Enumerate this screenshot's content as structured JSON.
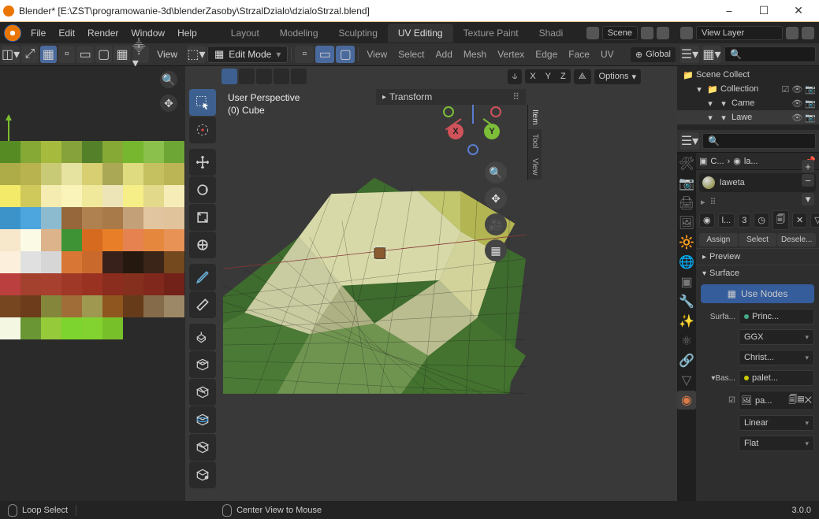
{
  "titlebar": {
    "title": "Blender* [E:\\ZST\\programowanie-3d\\blenderZasoby\\StrzalDzialo\\dzialoStrzal.blend]"
  },
  "topmenu": {
    "items": [
      "File",
      "Edit",
      "Render",
      "Window",
      "Help"
    ],
    "tabs": [
      "Layout",
      "Modeling",
      "Sculpting",
      "UV Editing",
      "Texture Paint",
      "Shadi"
    ],
    "active_tab": "UV Editing",
    "scene": "Scene",
    "viewlayer": "View Layer"
  },
  "uv_header": {
    "view": "View"
  },
  "vp_header": {
    "mode": "Edit Mode",
    "menus": [
      "View",
      "Select",
      "Add",
      "Mesh",
      "Vertex",
      "Edge",
      "Face",
      "UV"
    ],
    "orientation": "Global"
  },
  "vp_subheader": {
    "axes": [
      "X",
      "Y",
      "Z"
    ],
    "options": "Options"
  },
  "vp_info": {
    "perspective": "User Perspective",
    "object": "(0) Cube"
  },
  "npanel": {
    "header": "Transform",
    "tabs": [
      "Item",
      "Tool",
      "View"
    ]
  },
  "outliner": {
    "rows": [
      {
        "indent": 0,
        "icon": "📁",
        "name": "Scene Collect"
      },
      {
        "indent": 1,
        "icon": "📁",
        "name": "Collection",
        "toggles": [
          "☑",
          "👁",
          "📷"
        ]
      },
      {
        "indent": 2,
        "icon": "▾",
        "name": "Came",
        "toggles": [
          "👁",
          "📷"
        ]
      },
      {
        "indent": 2,
        "icon": "▾",
        "name": "Lawe",
        "toggles": [
          "👁",
          "📷"
        ],
        "sel": true
      }
    ]
  },
  "props": {
    "crumb_obj": "C...",
    "crumb_mat": "la...",
    "material": "laweta",
    "active_slot_index": "3",
    "link_label": "l...",
    "assign": "Assign",
    "select": "Select",
    "deselect": "Desele...",
    "preview": "Preview",
    "surface": "Surface",
    "usenodes": "Use Nodes",
    "surfa_label": "Surfa...",
    "shader": "Princ...",
    "ggx": "GGX",
    "christ": "Christ...",
    "base_label": "Bas...",
    "palette": "palet...",
    "pa_label": "pa...",
    "linear": "Linear",
    "flat": "Flat"
  },
  "status": {
    "left": "Loop Select",
    "hint": "Center View to Mouse",
    "version": "3.0.0"
  },
  "palette_colors": [
    "#568b24",
    "#86a936",
    "#a6ba3d",
    "#86a23a",
    "#54802a",
    "#86a936",
    "#77b72f",
    "#8ac04b",
    "#6ea636",
    "#aeac48",
    "#b8b34e",
    "#c9ca75",
    "#e6e2a0",
    "#d8cf73",
    "#aaa855",
    "#dedb80",
    "#c6c160",
    "#bcb555",
    "#f4ea6a",
    "#cfc85b",
    "#f4ecb0",
    "#fbf4ba",
    "#f0e99b",
    "#ede5b8",
    "#f6ee86",
    "#e2da8a",
    "#f6ecb8",
    "#3b93c9",
    "#4da6de",
    "#8cbbd0",
    "#95673b",
    "#b08150",
    "#a87949",
    "#c4a078",
    "#e1c5a0",
    "#e0c39b",
    "#f7e8cb",
    "#fbfae5",
    "#dcb38a",
    "#3e9435",
    "#d66a1e",
    "#e87f28",
    "#e68250",
    "#e5883d",
    "#e89255",
    "#fcf0dc",
    "#e0e0e0",
    "#d6d6d6",
    "#d87735",
    "#c96a2c",
    "#38211a",
    "#25180f",
    "#3a2518",
    "#74491e",
    "#bc3f3f",
    "#a4412e",
    "#a84030",
    "#a03828",
    "#9a3222",
    "#8a2c1e",
    "#85301e",
    "#80281c",
    "#722218",
    "#754620",
    "#6c3c1b",
    "#84863b",
    "#a06d38",
    "#9e9850",
    "#90561f",
    "#663b1a",
    "#866b4a",
    "#9c8866",
    "#f4f7e2",
    "#6a9633",
    "#95cb3a",
    "#7ed42e",
    "#82d230",
    "#78c02a",
    "#",
    "#",
    ""
  ]
}
